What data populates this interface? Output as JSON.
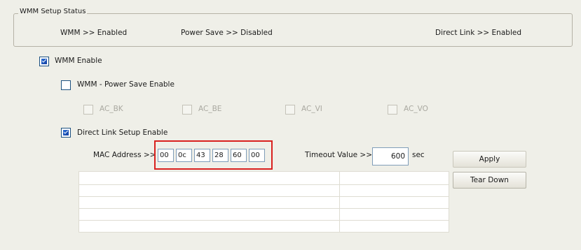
{
  "wmm_setup_status": {
    "title": "WMM Setup Status",
    "wmm": "WMM >> Enabled",
    "power_save": "Power Save >> Disabled",
    "direct_link": "Direct Link >> Enabled"
  },
  "options": {
    "wmm_enable": {
      "label": "WMM Enable",
      "checked": true
    },
    "wmm_power_save_enable": {
      "label": "WMM - Power Save Enable",
      "checked": false
    },
    "ac_bk": {
      "label": "AC_BK",
      "checked": false,
      "disabled": true
    },
    "ac_be": {
      "label": "AC_BE",
      "checked": false,
      "disabled": true
    },
    "ac_vi": {
      "label": "AC_VI",
      "checked": false,
      "disabled": true
    },
    "ac_vo": {
      "label": "AC_VO",
      "checked": false,
      "disabled": true
    },
    "direct_link_setup_enable": {
      "label": "Direct Link Setup Enable",
      "checked": true
    }
  },
  "direct_link": {
    "mac_label": "MAC Address >>",
    "mac_octets": [
      "00",
      "0c",
      "43",
      "28",
      "60",
      "00"
    ],
    "timeout_label": "Timeout Value >>",
    "timeout_value": "600",
    "timeout_unit": "sec",
    "apply_label": "Apply",
    "tear_down_label": "Tear Down"
  },
  "colors": {
    "background": "#efefe8",
    "highlight_border": "#d9211f",
    "checkbox_fill": "#1440a0"
  }
}
